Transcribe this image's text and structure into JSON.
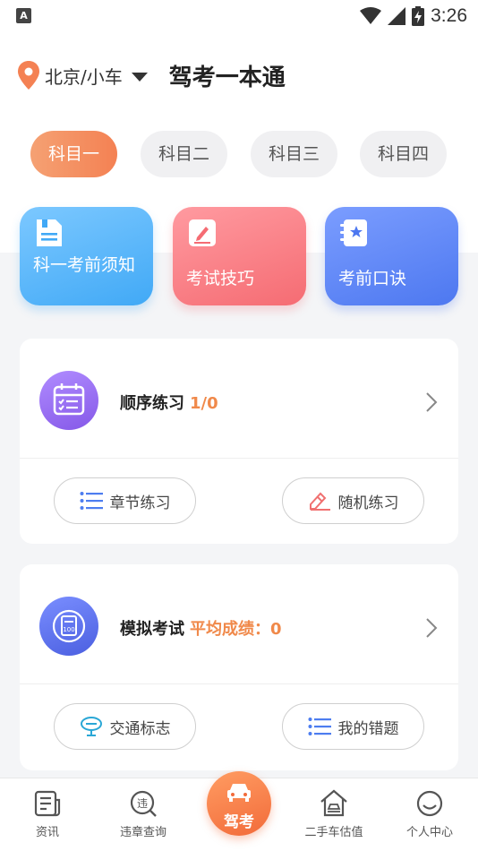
{
  "status_bar": {
    "app_badge": "A",
    "time": "3:26",
    "icons": [
      "wifi-icon",
      "signal-icon",
      "battery-charging-icon"
    ]
  },
  "header": {
    "location": "北京/小车",
    "title": "驾考一本通"
  },
  "subject_tabs": [
    {
      "label": "科目一",
      "active": true
    },
    {
      "label": "科目二",
      "active": false
    },
    {
      "label": "科目三",
      "active": false
    },
    {
      "label": "科目四",
      "active": false
    }
  ],
  "quick_cards": [
    {
      "label": "科一考前须知",
      "icon": "document-icon"
    },
    {
      "label": "考试技巧",
      "icon": "pencil-note-icon"
    },
    {
      "label": "考前口诀",
      "icon": "star-notebook-icon"
    }
  ],
  "sequential_practice": {
    "title": "顺序练习",
    "progress": "1/0",
    "buttons": [
      "章节练习",
      "随机练习"
    ]
  },
  "mock_exam": {
    "title": "模拟考试",
    "score_label": "平均成绩：0",
    "buttons": [
      "交通标志",
      "我的错题"
    ]
  },
  "bottom_nav": {
    "items": [
      {
        "label": "资讯",
        "icon": "news-icon"
      },
      {
        "label": "违章查询",
        "icon": "violation-icon"
      },
      {
        "label": "驾考",
        "icon": "car-icon",
        "center": true
      },
      {
        "label": "二手车估值",
        "icon": "house-car-icon"
      },
      {
        "label": "个人中心",
        "icon": "smile-icon"
      }
    ]
  },
  "colors": {
    "accent": "#f48153",
    "highlight": "#f0894a",
    "blue": "#4d7df0"
  }
}
